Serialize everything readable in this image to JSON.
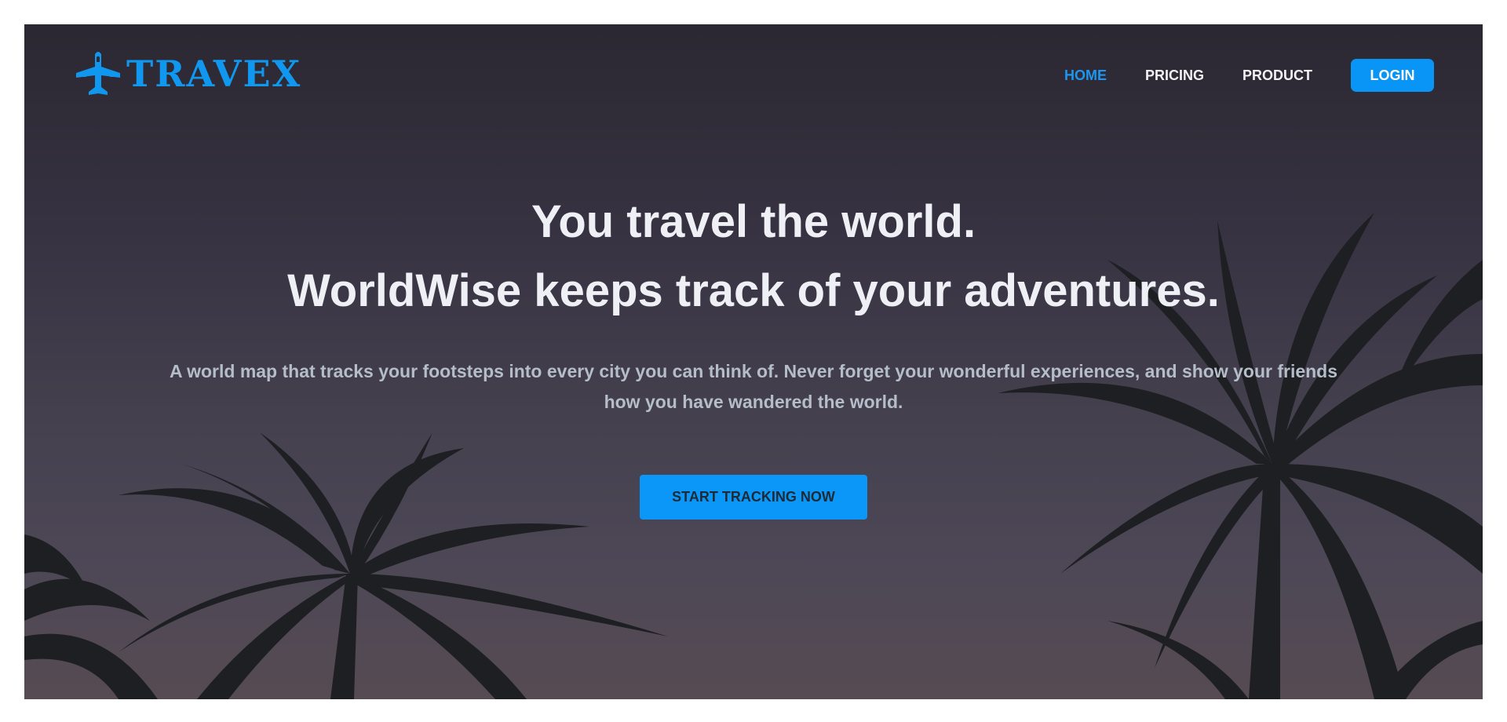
{
  "brand": {
    "name": "TRAVEX",
    "icon": "airplane-icon",
    "color": "#1098f0"
  },
  "nav": {
    "items": [
      {
        "label": "HOME",
        "active": true
      },
      {
        "label": "PRICING",
        "active": false
      },
      {
        "label": "PRODUCT",
        "active": false
      }
    ],
    "login_label": "LOGIN"
  },
  "hero": {
    "heading_line1": "You travel the world.",
    "heading_line2": "WorldWise keeps track of your adventures.",
    "subtitle": "A world map that tracks your footsteps into every city you can think of. Never forget your wonderful experiences, and show your friends how you have wandered the world.",
    "cta_label": "START TRACKING NOW",
    "background": "palm-trees-dusk-photo"
  },
  "colors": {
    "accent": "#0995f6",
    "active_link": "#1e96f0",
    "heading_text": "#eef0f5",
    "subtitle_text": "#b4bdc8"
  }
}
